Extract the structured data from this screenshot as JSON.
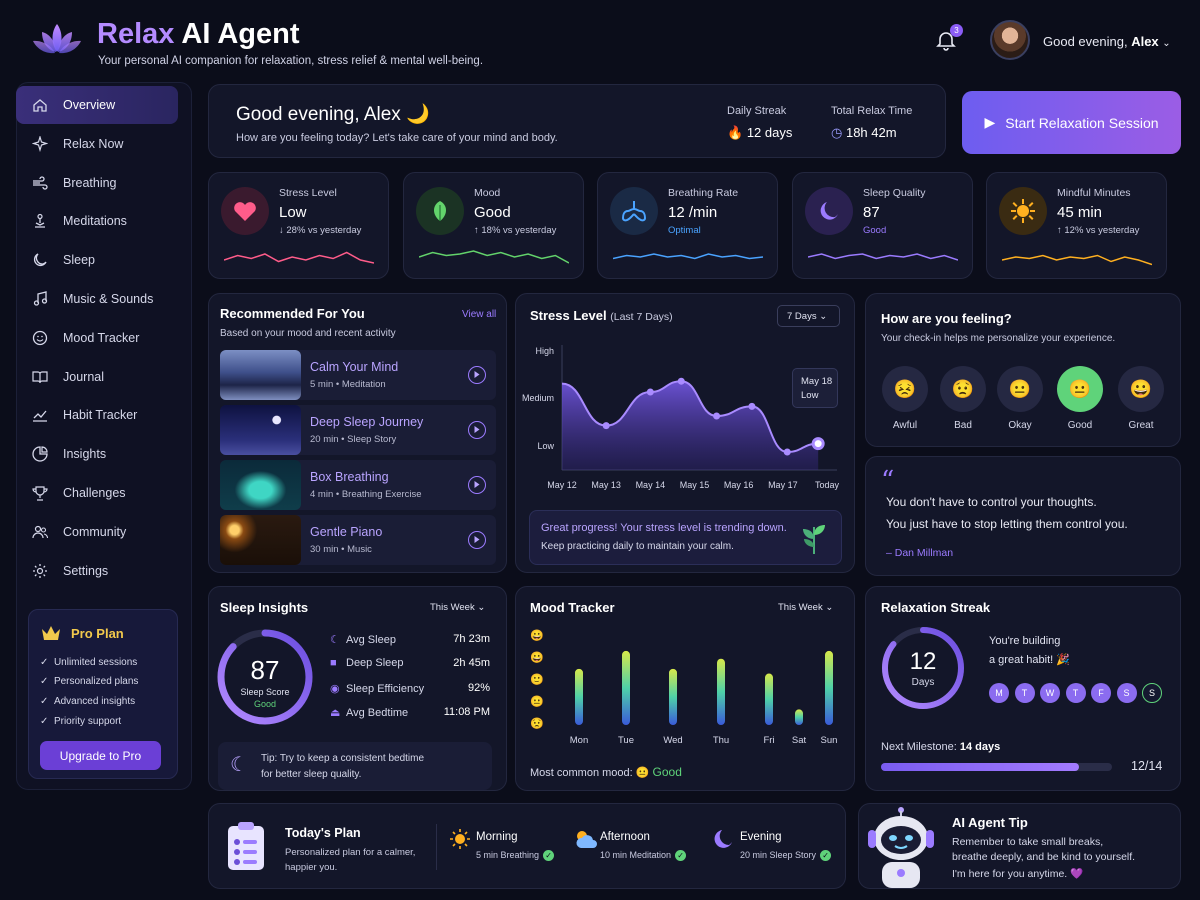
{
  "header": {
    "title_part1": "Relax",
    "title_part2": " AI Agent",
    "subtitle": "Your personal AI companion for relaxation, stress relief & mental well-being.",
    "notification_count": "3",
    "greeting_prefix": "Good evening, ",
    "user_name": "Alex"
  },
  "sidebar": {
    "items": [
      {
        "label": "Overview",
        "icon": "home-icon"
      },
      {
        "label": "Relax Now",
        "icon": "sparkle-icon"
      },
      {
        "label": "Breathing",
        "icon": "wind-icon"
      },
      {
        "label": "Meditations",
        "icon": "meditation-icon"
      },
      {
        "label": "Sleep",
        "icon": "moon-icon"
      },
      {
        "label": "Music & Sounds",
        "icon": "music-icon"
      },
      {
        "label": "Mood Tracker",
        "icon": "smile-icon"
      },
      {
        "label": "Journal",
        "icon": "book-icon"
      },
      {
        "label": "Habit Tracker",
        "icon": "chart-line-icon"
      },
      {
        "label": "Insights",
        "icon": "pie-icon"
      },
      {
        "label": "Challenges",
        "icon": "trophy-icon"
      },
      {
        "label": "Community",
        "icon": "users-icon"
      },
      {
        "label": "Settings",
        "icon": "gear-icon"
      }
    ],
    "pro": {
      "title": "Pro Plan",
      "features": [
        "Unlimited sessions",
        "Personalized plans",
        "Advanced insights",
        "Priority support"
      ],
      "button": "Upgrade to Pro"
    }
  },
  "welcome": {
    "greeting": "Good evening, Alex 🌙",
    "question": "How are you feeling today? Let's take care of your mind and body.",
    "streak_label": "Daily Streak",
    "streak_value": "12 days",
    "relax_label": "Total Relax Time",
    "relax_value": "18h 42m",
    "start_button": "Start Relaxation Session"
  },
  "stats": [
    {
      "label": "Stress Level",
      "value": "Low",
      "sub": "↓ 28% vs yesterday",
      "color": "#ff5c8a"
    },
    {
      "label": "Mood",
      "value": "Good",
      "sub": "↑ 18% vs yesterday",
      "color": "#63d36b"
    },
    {
      "label": "Breathing Rate",
      "value": "12 /min",
      "sub": "Optimal",
      "color": "#4aa3ff"
    },
    {
      "label": "Sleep Quality",
      "value": "87",
      "sub": "Good",
      "color": "#9b7bff"
    },
    {
      "label": "Mindful Minutes",
      "value": "45 min",
      "sub": "↑ 12% vs yesterday",
      "color": "#ffb020"
    }
  ],
  "recommended": {
    "title": "Recommended For You",
    "view_all": "View all",
    "subtitle": "Based on your mood and recent activity",
    "items": [
      {
        "title": "Calm Your Mind",
        "meta": "5 min • Meditation"
      },
      {
        "title": "Deep Sleep Journey",
        "meta": "20 min • Sleep Story"
      },
      {
        "title": "Box Breathing",
        "meta": "4 min • Breathing Exercise"
      },
      {
        "title": "Gentle Piano",
        "meta": "30 min • Music"
      }
    ]
  },
  "stress_chart": {
    "title": "Stress Level",
    "title_suffix": "(Last 7 Days)",
    "range": "7 Days",
    "tooltip_date": "May 18",
    "tooltip_value": "Low",
    "message": "Great progress! Your stress level is trending down.",
    "message_sub": "Keep practicing daily to maintain your calm."
  },
  "chart_data": {
    "type": "area",
    "title": "Stress Level",
    "x": [
      "May 12",
      "May 13",
      "May 14",
      "May 15",
      "May 16",
      "May 17",
      "Today"
    ],
    "y_ticks": [
      "High",
      "Medium",
      "Low"
    ],
    "values": [
      0.72,
      0.37,
      0.65,
      0.74,
      0.45,
      0.53,
      0.15,
      0.22
    ],
    "x_points": [
      0,
      1,
      2,
      2.7,
      3.5,
      4.3,
      5.1,
      5.8
    ],
    "ylim": [
      0,
      1
    ]
  },
  "feeling": {
    "title": "How are you feeling?",
    "subtitle": "Your check-in helps me personalize your experience.",
    "options": [
      "Awful",
      "Bad",
      "Okay",
      "Good",
      "Great"
    ],
    "selected": "Good"
  },
  "quote": {
    "line1": "You don't have to control your thoughts.",
    "line2": "You just have to stop letting them control you.",
    "author": "– Dan Millman"
  },
  "sleep": {
    "title": "Sleep Insights",
    "range": "This Week",
    "score": "87",
    "score_label": "Sleep Score",
    "score_status": "Good",
    "score_fraction": 0.87,
    "rows": [
      {
        "label": "Avg Sleep",
        "value": "7h 23m"
      },
      {
        "label": "Deep Sleep",
        "value": "2h 45m"
      },
      {
        "label": "Sleep Efficiency",
        "value": "92%"
      },
      {
        "label": "Avg Bedtime",
        "value": "11:08 PM"
      }
    ],
    "tip": "Tip: Try to keep a consistent bedtime",
    "tip2": "for better sleep quality."
  },
  "mood_tracker": {
    "title": "Mood Tracker",
    "range": "This Week",
    "days": [
      "Mon",
      "Tue",
      "Wed",
      "Thu",
      "Fri",
      "Sat",
      "Sun"
    ],
    "levels": [
      0.72,
      0.95,
      0.72,
      0.85,
      0.66,
      0.2,
      0.95
    ],
    "common_label": "Most common mood:",
    "common_value": "Good"
  },
  "streak": {
    "title": "Relaxation Streak",
    "days": "12",
    "days_label": "Days",
    "text1": "You're building",
    "text2": "a great habit! 🎉",
    "week": [
      "M",
      "T",
      "W",
      "T",
      "F",
      "S",
      "S"
    ],
    "milestone_label": "Next Milestone:",
    "milestone_value": "14 days",
    "progress": "12/14",
    "progress_fraction": 0.857
  },
  "plan": {
    "title": "Today's Plan",
    "subtitle1": "Personalized plan for a calmer,",
    "subtitle2": "happier you.",
    "items": [
      {
        "label": "Morning",
        "detail": "5 min Breathing"
      },
      {
        "label": "Afternoon",
        "detail": "10 min Meditation"
      },
      {
        "label": "Evening",
        "detail": "20 min Sleep Story"
      }
    ]
  },
  "tip": {
    "title": "AI Agent Tip",
    "line1": "Remember to take small breaks,",
    "line2": "breathe deeply, and be kind to yourself.",
    "line3": "I'm here for you anytime. 💜"
  }
}
